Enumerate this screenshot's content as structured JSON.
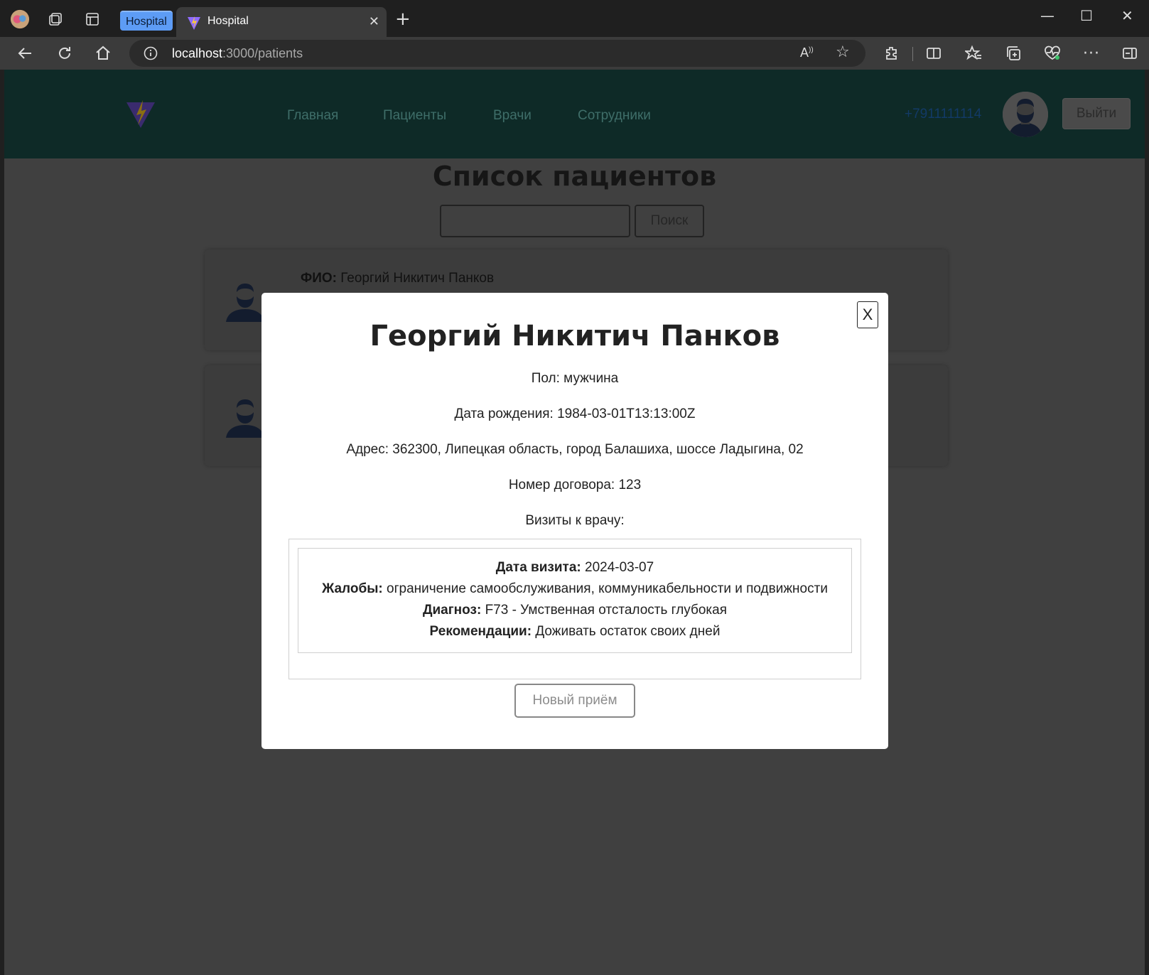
{
  "browser": {
    "tab_group_label": "Hospital",
    "tab_title": "Hospital",
    "url_host": "localhost",
    "url_rest": ":3000/patients",
    "icons": [
      "profile-icon",
      "workspaces-icon",
      "tab-actions-icon",
      "close-icon",
      "plus-icon",
      "minimize-icon",
      "maximize-icon",
      "window-close-icon",
      "back-icon",
      "refresh-icon",
      "home-icon",
      "info-icon",
      "read-aloud-icon",
      "favorite-icon",
      "extensions-icon",
      "split-screen-icon",
      "favorites-icon",
      "collections-icon",
      "health-icon",
      "more-icon",
      "sidebar-icon"
    ]
  },
  "header": {
    "nav": [
      "Главная",
      "Пациенты",
      "Врачи",
      "Сотрудники"
    ],
    "phone": "+7911111114",
    "logout_label": "Выйти"
  },
  "page": {
    "title": "Список пациентов",
    "search_button": "Поиск",
    "search_value": "",
    "cards": [
      {
        "fio_label": "ФИО:",
        "fio_value": "Георгий Никитич Панков"
      }
    ]
  },
  "modal": {
    "close_label": "X",
    "name": "Георгий Никитич Панков",
    "gender": "Пол: мужчина",
    "birth": "Дата рождения: 1984-03-01T13:13:00Z",
    "address": "Адрес: 362300, Липецкая область, город Балашиха, шоссе Ладыгина, 02",
    "contract": "Номер договора: 123",
    "visits_heading": "Визиты к врачу:",
    "visit": {
      "date_label": "Дата визита:",
      "date_value": "2024-03-07",
      "complaints_label": "Жалобы:",
      "complaints_value": "ограничение самообслуживания, коммуникабельности и подвижности",
      "diagnosis_label": "Диагноз:",
      "diagnosis_value": "F73 - Умственная отсталость глубокая",
      "recommend_label": "Рекомендации:",
      "recommend_value": "Доживать остаток своих дней"
    },
    "new_visit_button": "Новый приём"
  },
  "colors": {
    "navbar": "#0e2a27",
    "overlay_page": "#404040",
    "modal_bg": "#ffffff",
    "tab_group": "#5d9cf5"
  }
}
